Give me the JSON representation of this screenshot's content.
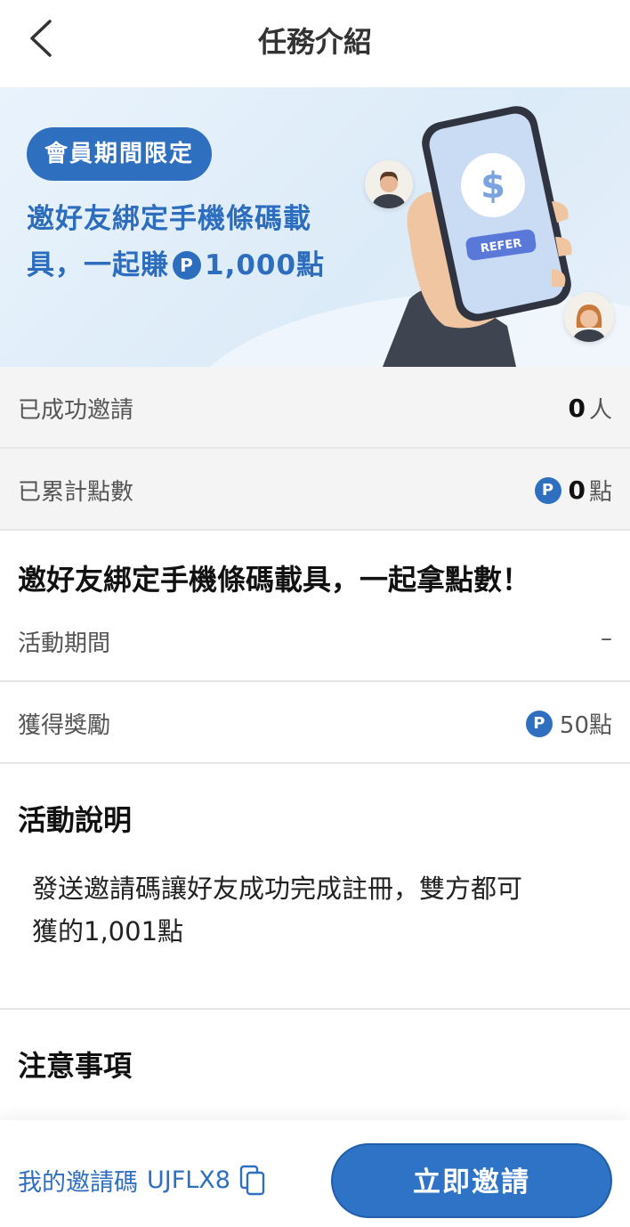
{
  "header": {
    "title": "任務介紹"
  },
  "banner": {
    "badge": "會員期間限定",
    "line1": "邀好友綁定手機條碼載",
    "line2_prefix": "具，一起賺",
    "line2_points": "1,000點",
    "p_glyph": "P",
    "refer_label": "REFER",
    "dollar_glyph": "$"
  },
  "stats": {
    "invited_label": "已成功邀請",
    "invited_value": "0",
    "invited_unit": "人",
    "points_label": "已累計點數",
    "points_value": "0",
    "points_unit": "點"
  },
  "task": {
    "title": "邀好友綁定手機條碼載具，一起拿點數！",
    "period_label": "活動期間",
    "period_value": "–",
    "reward_label": "獲得獎勵",
    "reward_value": "50點"
  },
  "description": {
    "title": "活動說明",
    "text_line1": "發送邀請碼讓好友成功完成註冊，雙方都可",
    "text_line2": "獲的1,001點"
  },
  "notes": {
    "title": "注意事項"
  },
  "bottom": {
    "invite_code_label": "我的邀請碼",
    "invite_code": "UJFLX8",
    "invite_button": "立即邀請"
  },
  "colors": {
    "accent": "#2f6fc0",
    "banner_text": "#2d6dbd"
  },
  "icons": {
    "back": "chevron-left-icon",
    "copy": "copy-icon",
    "points": "points-p-icon"
  }
}
